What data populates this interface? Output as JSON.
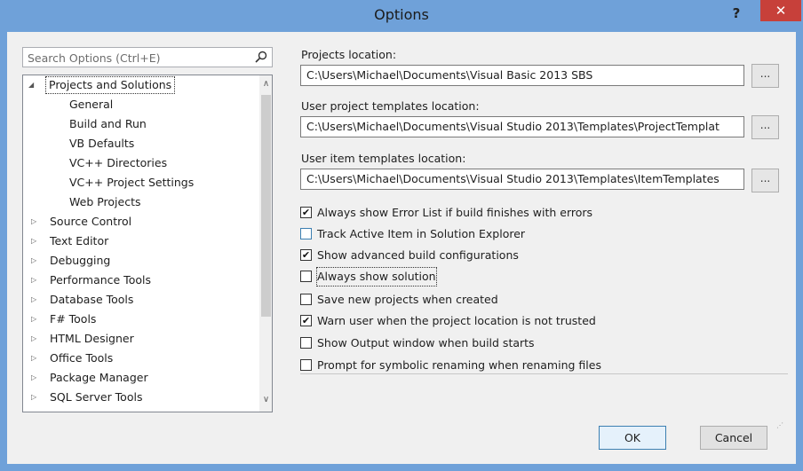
{
  "window": {
    "title": "Options",
    "help_label": "?",
    "close_label": "✕"
  },
  "search": {
    "placeholder": "Search Options (Ctrl+E)",
    "icon": "search-icon"
  },
  "tree": {
    "items": [
      {
        "label": "Projects and Solutions",
        "expanded": true,
        "selected": true
      },
      {
        "label": "General"
      },
      {
        "label": "Build and Run"
      },
      {
        "label": "VB Defaults"
      },
      {
        "label": "VC++ Directories"
      },
      {
        "label": "VC++ Project Settings"
      },
      {
        "label": "Web Projects"
      },
      {
        "label": "Source Control"
      },
      {
        "label": "Text Editor"
      },
      {
        "label": "Debugging"
      },
      {
        "label": "Performance Tools"
      },
      {
        "label": "Database Tools"
      },
      {
        "label": "F# Tools"
      },
      {
        "label": "HTML Designer"
      },
      {
        "label": "Office Tools"
      },
      {
        "label": "Package Manager"
      },
      {
        "label": "SQL Server Tools"
      }
    ]
  },
  "settings": {
    "projects_location_label": "Projects location:",
    "projects_location_value": "C:\\Users\\Michael\\Documents\\Visual Basic 2013 SBS",
    "project_templates_label": "User project templates location:",
    "project_templates_value": "C:\\Users\\Michael\\Documents\\Visual Studio 2013\\Templates\\ProjectTemplat",
    "item_templates_label": "User item templates location:",
    "item_templates_value": "C:\\Users\\Michael\\Documents\\Visual Studio 2013\\Templates\\ItemTemplates",
    "browse_label": "..."
  },
  "options": [
    {
      "label": "Always show Error List if build finishes with errors",
      "checked": true
    },
    {
      "label": "Track Active Item in Solution Explorer",
      "checked": false
    },
    {
      "label": "Show advanced build configurations",
      "checked": true
    },
    {
      "label": "Always show solution",
      "checked": false,
      "focused": true
    },
    {
      "label": "Save new projects when created",
      "checked": false
    },
    {
      "label": "Warn user when the project location is not trusted",
      "checked": true
    },
    {
      "label": "Show Output window when build starts",
      "checked": false
    },
    {
      "label": "Prompt for symbolic renaming when renaming files",
      "checked": false
    }
  ],
  "footer": {
    "ok_label": "OK",
    "cancel_label": "Cancel"
  },
  "colors": {
    "frame": "#6fa1d9",
    "close": "#c7403a",
    "accent": "#3c7fb1"
  }
}
